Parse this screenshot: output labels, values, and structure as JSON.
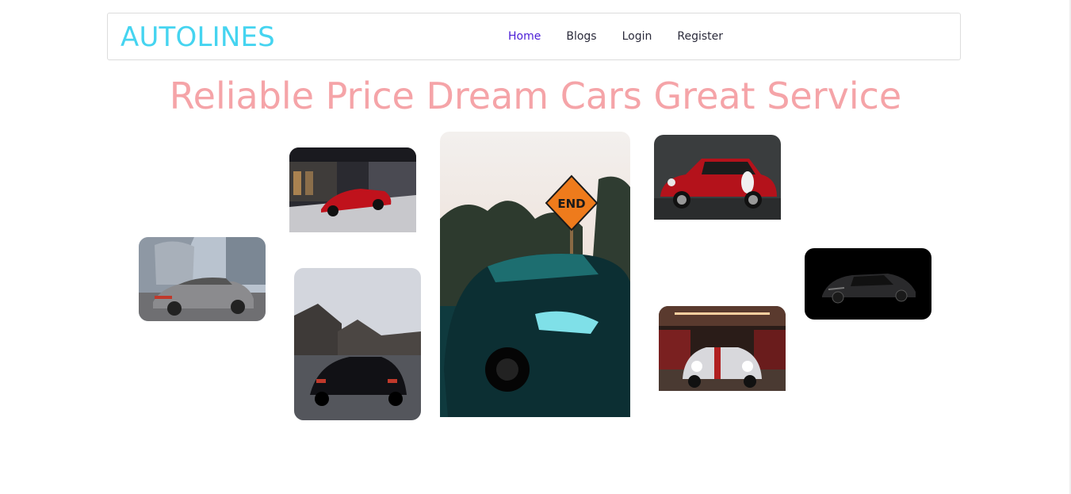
{
  "brand": {
    "name": "AUTOLINES"
  },
  "nav": {
    "items": [
      {
        "label": "Home",
        "active": true
      },
      {
        "label": "Blogs",
        "active": false
      },
      {
        "label": "Login",
        "active": false
      },
      {
        "label": "Register",
        "active": false
      }
    ]
  },
  "hero": {
    "headline": "Reliable Price Dream Cars Great Service"
  },
  "road_sign": {
    "text": "END"
  },
  "colors": {
    "brand": "#45d4f0",
    "headline": "#f5a4a8",
    "nav_active": "#4b1dd6",
    "nav_text": "#2b2b3b"
  }
}
